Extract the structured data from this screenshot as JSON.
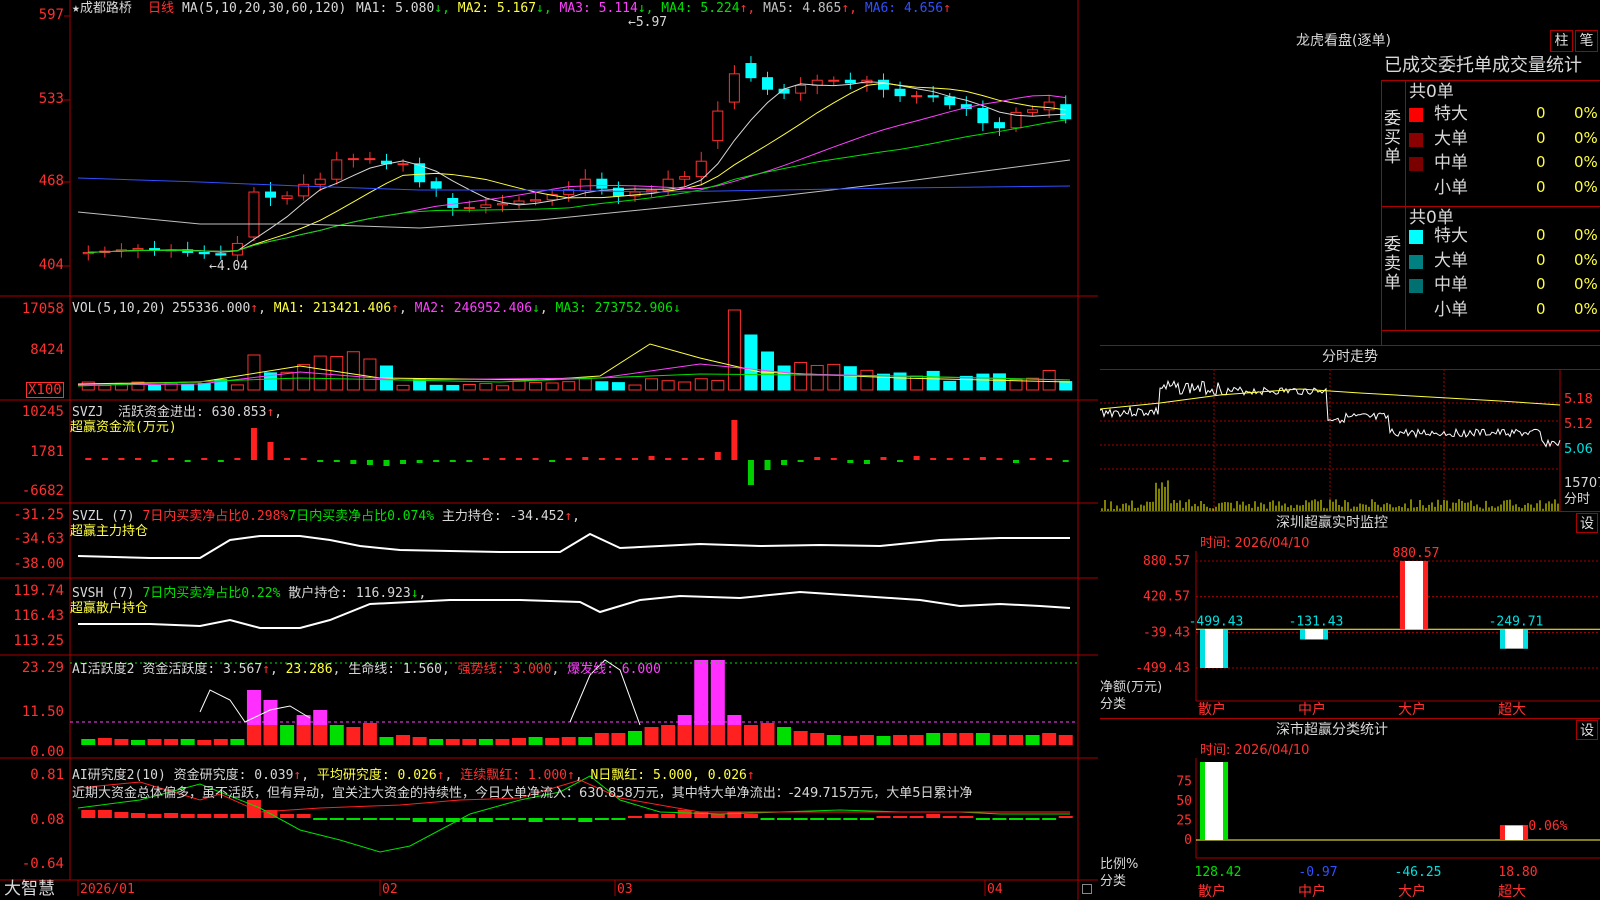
{
  "stock": {
    "name": "★成都路桥",
    "period": "日线"
  },
  "panels": {
    "kline": {
      "ma_label": "MA(5,10,20,30,60,120)",
      "mas": [
        {
          "label": "MA1: 5.080",
          "arrow": "↓",
          "color": "#d8d8d8"
        },
        {
          "label": "MA2: 5.167",
          "arrow": "↓",
          "color": "#ffff40"
        },
        {
          "label": "MA3: 5.114",
          "arrow": "↓",
          "color": "#ff40ff"
        },
        {
          "label": "MA4: 5.224",
          "arrow": "↑",
          "color": "#00e000"
        },
        {
          "label": "MA5: 4.865",
          "arrow": "↑",
          "color": "#c0c0c0"
        },
        {
          "label": "MA6: 4.656",
          "arrow": "↑",
          "color": "#3050ff"
        }
      ],
      "axis": [
        "597",
        "533",
        "468",
        "404"
      ],
      "high_label": "5.97",
      "low_label": "4.04"
    },
    "vol": {
      "label": "VOL(5,10,20)",
      "value": "255336.000",
      "ma1": "MA1: 213421.406",
      "ma2": "MA2: 246952.406",
      "ma3": "MA3: 273752.906",
      "axis": [
        "17058",
        "8424"
      ],
      "unit": "X100"
    },
    "svzj": {
      "label": "SVZJ",
      "text": "活跃资金进出: 630.853",
      "sub": "超赢资金流(万元)",
      "axis": [
        "10245",
        "1781",
        "-6682"
      ]
    },
    "svzl": {
      "label": "SVZL (7)",
      "t1": "7日内买卖净占比0.298%",
      "t2": "7日内买卖净占比0.074%",
      "t3": "主力持仓: -34.452",
      "sub": "超赢主力持仓",
      "axis": [
        "-31.25",
        "-34.63",
        "-38.00"
      ]
    },
    "svsh": {
      "label": "SVSH (7)",
      "t1": "7日内买卖净占比0.22%",
      "t2": "散户持仓: 116.923",
      "sub": "超赢散户持仓",
      "axis": [
        "119.74",
        "116.43",
        "113.25"
      ]
    },
    "ai1": {
      "label": "AI活跃度2",
      "t1": "资金活跃度: 3.567",
      "t2": "23.286",
      "t3": "生命线: 1.560",
      "t4": "强势线: 3.000",
      "t5": "爆发线: 6.000",
      "axis": [
        "23.29",
        "11.50",
        "0.00"
      ]
    },
    "ai2": {
      "label": "AI研究度2(10)",
      "t1": "资金研究度: 0.039",
      "t2": "平均研究度: 0.026",
      "t3": "连续飘红: 1.000",
      "t4": "N日飘红: 5.000, 0.026",
      "comment": "近期大资金总体偏多，虽不活跃，但有异动，宜关注大资金的持续性，今日大单净流入：630.858万元，其中特大单净流出：-249.715万元，大单5日累计净",
      "axis": [
        "0.81",
        "0.08",
        "-0.64"
      ]
    }
  },
  "xaxis": [
    "2026/01",
    "02",
    "03",
    "04"
  ],
  "brand": "大智慧",
  "right": {
    "lhp_title": "龙虎看盘(逐单)",
    "btn_zhu": "柱",
    "btn_bi": "笔",
    "tabs": "已成交委托单成交量统计",
    "buy_side": "委买单",
    "sell_side": "委卖单",
    "buy_total": "共0单",
    "sell_total": "共0单",
    "rows": [
      {
        "label": "特大",
        "n": "0",
        "p": "0%"
      },
      {
        "label": "大单",
        "n": "0",
        "p": "0%"
      },
      {
        "label": "中单",
        "n": "0",
        "p": "0%"
      },
      {
        "label": "小单",
        "n": "0",
        "p": "0%"
      }
    ],
    "buy_colors": [
      "#ff0000",
      "#8b0000",
      "#7a0000",
      ""
    ],
    "sell_colors": [
      "#00ffff",
      "#008080",
      "#007070",
      ""
    ],
    "fs_title": "分时走势",
    "fs_axis": [
      "5.18",
      "5.12",
      "5.06"
    ],
    "fs_vol": "15707",
    "fs_unit": "分时",
    "mon_title": "深圳超赢实时监控",
    "mon_date": "时间: 2026/04/10",
    "btn_set": "设",
    "mon_axis": [
      "880.57",
      "420.57",
      "-39.43",
      "-499.43"
    ],
    "mon_ylabel": "净额(万元)",
    "mon_xlabel": "分类",
    "mon_cats": [
      "散户",
      "中户",
      "大户",
      "超大"
    ],
    "cls_title": "深市超赢分类统计",
    "cls_date": "时间: 2026/04/10",
    "cls_axis": [
      "75",
      "50",
      "25",
      "0"
    ],
    "cls_ylabel": "比例%",
    "cls_xlabel": "分类"
  },
  "chart_data": [
    {
      "type": "bar",
      "title": "深圳超赢实时监控",
      "categories": [
        "散户",
        "中户",
        "大户",
        "超大"
      ],
      "values": [
        -499.43,
        -131.43,
        880.57,
        -249.71
      ],
      "ylabel": "净额(万元)",
      "ylim": [
        -499.43,
        880.57
      ]
    },
    {
      "type": "bar",
      "title": "深市超赢分类统计",
      "categories": [
        "散户",
        "中户",
        "大户",
        "超大"
      ],
      "values": [
        128.42,
        -0.97,
        -46.25,
        18.8
      ],
      "labels": [
        "",
        "",
        "",
        "-0.06%"
      ],
      "ylabel": "比例%",
      "ylim": [
        0,
        100
      ]
    }
  ]
}
